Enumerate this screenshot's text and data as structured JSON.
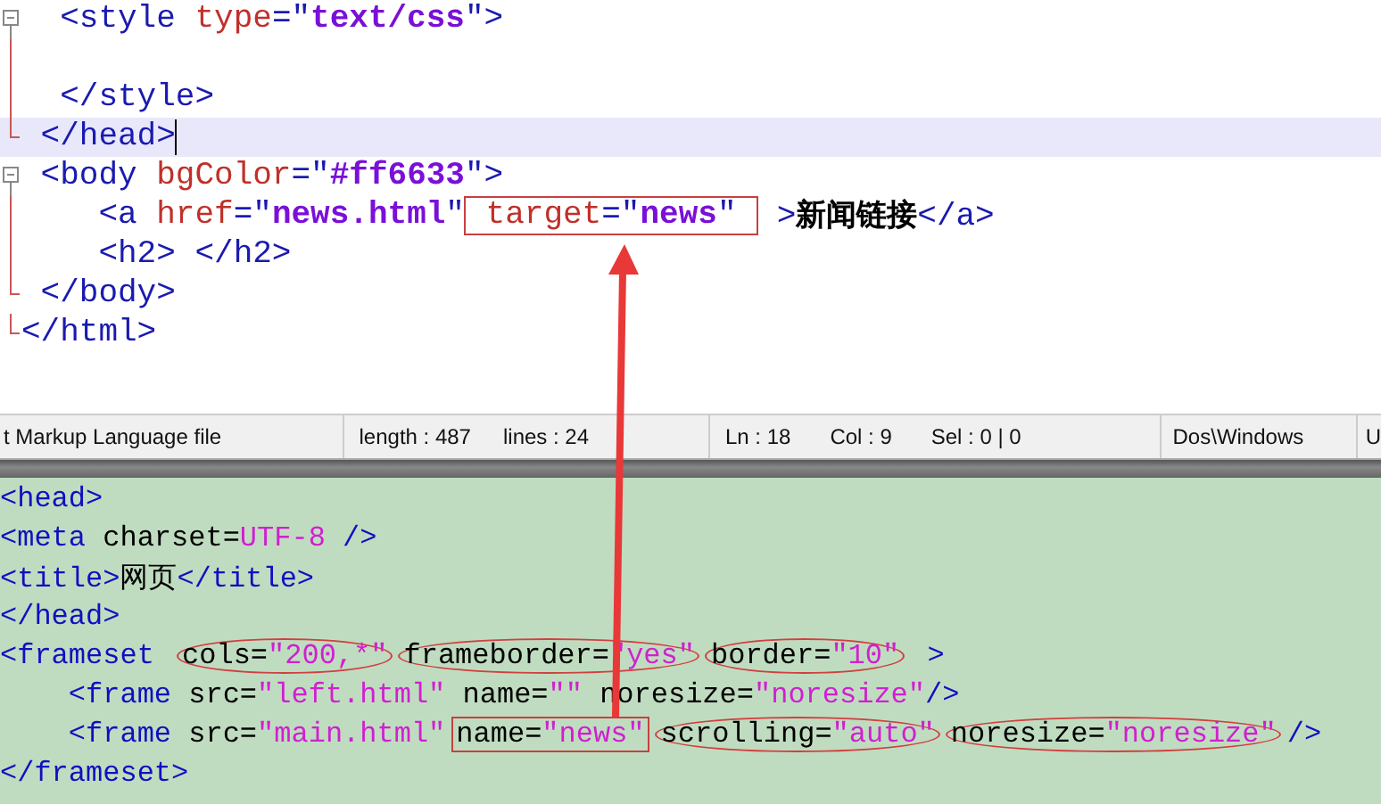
{
  "top_editor": {
    "lines": [
      {
        "kind": "fold-start",
        "current": false,
        "segments": [
          {
            "kind": "plain",
            "tokens": [
              {
                "kind": "tag",
                "text": "  <style "
              },
              {
                "kind": "attr",
                "text": "type"
              },
              {
                "kind": "tag",
                "text": "=\""
              },
              {
                "kind": "value",
                "text": "text/css"
              },
              {
                "kind": "tag",
                "text": "\">"
              }
            ]
          }
        ]
      },
      {
        "kind": "fold-line",
        "current": false
      },
      {
        "kind": "fold-line",
        "current": false,
        "segments": [
          {
            "kind": "plain",
            "tokens": [
              {
                "kind": "tag",
                "text": "  </style>"
              }
            ]
          }
        ]
      },
      {
        "kind": "fold-end",
        "current": true,
        "segments": [
          {
            "kind": "plain",
            "tokens": [
              {
                "kind": "tag",
                "text": " </head>"
              }
            ]
          }
        ]
      },
      {
        "kind": "fold-start",
        "current": false,
        "segments": [
          {
            "kind": "plain",
            "tokens": [
              {
                "kind": "tag",
                "text": " <body "
              },
              {
                "kind": "attr",
                "text": "bgColor"
              },
              {
                "kind": "tag",
                "text": "=\""
              },
              {
                "kind": "value",
                "text": "#ff6633"
              },
              {
                "kind": "tag",
                "text": "\">"
              }
            ]
          }
        ]
      },
      {
        "kind": "fold-line",
        "current": false,
        "segments": [
          {
            "kind": "plain",
            "tokens": [
              {
                "kind": "tag",
                "text": "    <a "
              },
              {
                "kind": "attr",
                "text": "href"
              },
              {
                "kind": "tag",
                "text": "=\""
              },
              {
                "kind": "value",
                "text": "news.html"
              },
              {
                "kind": "tag",
                "text": "\""
              }
            ]
          },
          {
            "kind": "boxed",
            "tokens": [
              {
                "kind": "attr",
                "text": " target"
              },
              {
                "kind": "tag",
                "text": "=\""
              },
              {
                "kind": "value",
                "text": "news"
              },
              {
                "kind": "tag",
                "text": "\" "
              }
            ]
          },
          {
            "kind": "plain",
            "tokens": [
              {
                "kind": "tag",
                "text": " >"
              },
              {
                "kind": "text",
                "text": "新闻链接"
              },
              {
                "kind": "tag",
                "text": "</a>"
              }
            ]
          }
        ]
      },
      {
        "kind": "fold-line",
        "current": false,
        "segments": [
          {
            "kind": "plain",
            "tokens": [
              {
                "kind": "tag",
                "text": "    <h2> </h2>"
              }
            ]
          }
        ]
      },
      {
        "kind": "fold-end",
        "current": false,
        "segments": [
          {
            "kind": "plain",
            "tokens": [
              {
                "kind": "tag",
                "text": " </body>"
              }
            ]
          }
        ]
      },
      {
        "kind": "fold-end",
        "current": false,
        "segments": [
          {
            "kind": "plain",
            "tokens": [
              {
                "kind": "tag",
                "text": "</html>"
              }
            ]
          }
        ]
      }
    ]
  },
  "status_bar": [
    {
      "text": "t Markup Language file"
    },
    {
      "text": "length : 487",
      "text2": "lines : 24"
    },
    {
      "text": "Ln : 18",
      "text2": "Col : 9",
      "text3": "Sel : 0 | 0"
    },
    {
      "text": "Dos\\Windows"
    },
    {
      "text": "U"
    }
  ],
  "bottom_editor": {
    "lines": [
      {
        "segments": [
          {
            "kind": "plain",
            "tokens": [
              {
                "kind": "tag",
                "text": "<head>"
              }
            ]
          }
        ]
      },
      {
        "segments": [
          {
            "kind": "plain",
            "tokens": [
              {
                "kind": "tag",
                "text": "<meta "
              },
              {
                "kind": "attr",
                "text": "charset="
              },
              {
                "kind": "value",
                "text": "UTF-8"
              },
              {
                "kind": "tag",
                "text": " />"
              }
            ]
          }
        ]
      },
      {
        "segments": [
          {
            "kind": "plain",
            "tokens": [
              {
                "kind": "tag",
                "text": "<title>"
              },
              {
                "kind": "text",
                "text": "网页"
              },
              {
                "kind": "tag",
                "text": "</title>"
              }
            ]
          }
        ]
      },
      {
        "segments": [
          {
            "kind": "plain",
            "tokens": [
              {
                "kind": "tag",
                "text": "</head>"
              }
            ]
          }
        ]
      },
      {
        "segments": [
          {
            "kind": "plain",
            "tokens": [
              {
                "kind": "tag",
                "text": "<frameset "
              }
            ]
          },
          {
            "kind": "circled",
            "tokens": [
              {
                "kind": "attr",
                "text": "cols="
              },
              {
                "kind": "value",
                "text": "\"200,*\""
              }
            ]
          },
          {
            "kind": "circled",
            "tokens": [
              {
                "kind": "attr",
                "text": "frameborder="
              },
              {
                "kind": "value",
                "text": "\"yes\""
              }
            ]
          },
          {
            "kind": "circled",
            "tokens": [
              {
                "kind": "attr",
                "text": "border="
              },
              {
                "kind": "value",
                "text": "\"10\""
              }
            ]
          },
          {
            "kind": "plain",
            "tokens": [
              {
                "kind": "tag",
                "text": " >"
              }
            ]
          }
        ]
      },
      {
        "segments": [
          {
            "kind": "plain",
            "tokens": [
              {
                "kind": "tag",
                "text": "    <frame "
              },
              {
                "kind": "attr",
                "text": "src="
              },
              {
                "kind": "value",
                "text": "\"left.html\""
              },
              {
                "kind": "attr",
                "text": " name="
              },
              {
                "kind": "value",
                "text": "\"\""
              },
              {
                "kind": "attr",
                "text": " noresize="
              },
              {
                "kind": "value",
                "text": "\"noresize\""
              },
              {
                "kind": "tag",
                "text": "/>"
              }
            ]
          }
        ]
      },
      {
        "segments": [
          {
            "kind": "plain",
            "tokens": [
              {
                "kind": "tag",
                "text": "    <frame "
              },
              {
                "kind": "attr",
                "text": "src="
              },
              {
                "kind": "value",
                "text": "\"main.html\""
              }
            ]
          },
          {
            "kind": "boxed",
            "tokens": [
              {
                "kind": "attr",
                "text": "name="
              },
              {
                "kind": "value",
                "text": "\"news\""
              }
            ]
          },
          {
            "kind": "circled",
            "tokens": [
              {
                "kind": "attr",
                "text": "scrolling="
              },
              {
                "kind": "value",
                "text": "\"auto\""
              }
            ]
          },
          {
            "kind": "circled",
            "tokens": [
              {
                "kind": "attr",
                "text": "noresize="
              },
              {
                "kind": "value",
                "text": "\"noresize\""
              }
            ]
          },
          {
            "kind": "plain",
            "tokens": [
              {
                "kind": "tag",
                "text": "/>"
              }
            ]
          }
        ]
      },
      {
        "segments": [
          {
            "kind": "plain",
            "tokens": [
              {
                "kind": "tag",
                "text": "</frameset>"
              }
            ]
          }
        ]
      }
    ]
  }
}
